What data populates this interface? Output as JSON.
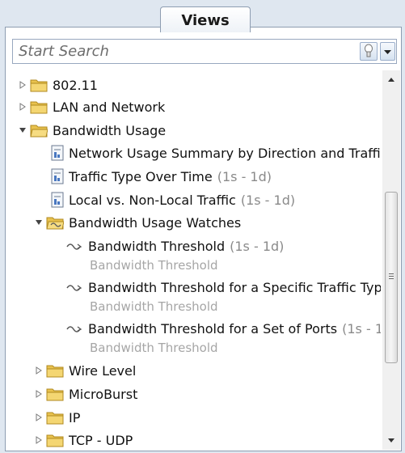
{
  "header": {
    "title": "Views"
  },
  "search": {
    "placeholder": "Start Search"
  },
  "tree": {
    "folders_top": [
      {
        "label": "802.11",
        "expanded": false
      },
      {
        "label": "LAN and Network",
        "expanded": false
      },
      {
        "label": "Bandwidth Usage",
        "expanded": true
      }
    ],
    "reports": [
      {
        "label": "Network Usage Summary by Direction and Traffi",
        "range": ""
      },
      {
        "label": "Traffic Type Over Time",
        "range": "(1s - 1d)"
      },
      {
        "label": "Local vs. Non-Local Traffic",
        "range": "(1s - 1d)"
      }
    ],
    "watch_folder": {
      "label": "Bandwidth Usage Watches",
      "expanded": true
    },
    "watches": [
      {
        "label": "Bandwidth Threshold",
        "range": "(1s - 1d)",
        "sub": "Bandwidth Threshold"
      },
      {
        "label": "Bandwidth Threshold for a Specific Traffic Typ",
        "range": "",
        "sub": "Bandwidth Threshold"
      },
      {
        "label": "Bandwidth Threshold for a Set of Ports",
        "range": "(1s - 1",
        "sub": "Bandwidth Threshold"
      }
    ],
    "folders_bottom": [
      {
        "label": "Wire Level",
        "expanded": false
      },
      {
        "label": "MicroBurst",
        "expanded": false
      },
      {
        "label": "IP",
        "expanded": false
      },
      {
        "label": "TCP - UDP",
        "expanded": false
      }
    ]
  },
  "colors": {
    "background": "#dfe7f0",
    "border": "#8e9db1",
    "folder": "#e9c24e",
    "subtext": "#a6a6a6"
  }
}
